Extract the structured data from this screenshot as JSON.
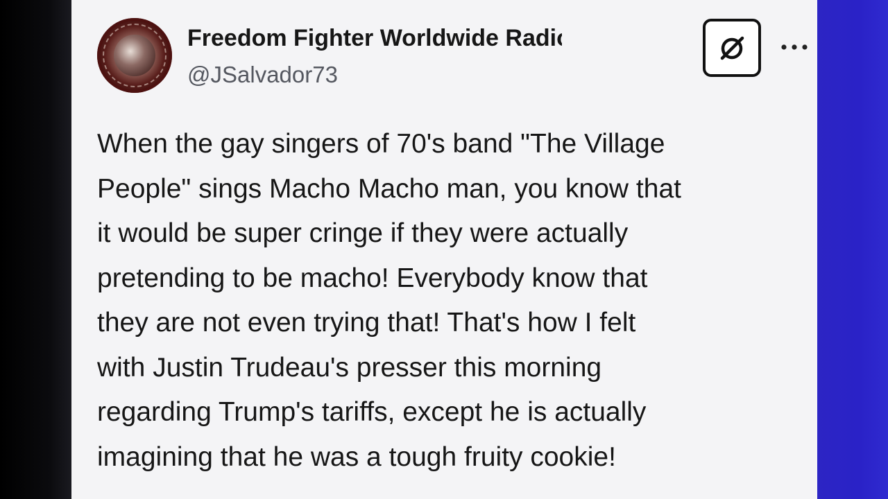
{
  "post": {
    "author": {
      "display_name": "Freedom Fighter Worldwide Radio ...",
      "handle": "@JSalvador73",
      "avatar_icon": "radio-station-avatar"
    },
    "actions": {
      "grok_icon": "grok-icon",
      "more_icon": "more-options-icon"
    },
    "text_lines": [
      "When the gay singers of 70's band \"The Village",
      "People\" sings Macho Macho man, you know that",
      "it would be super cringe if they were actually",
      "pretending to be macho! Everybody know that",
      "they are not even trying that! That's how I felt",
      "with Justin Trudeau's presser this morning",
      "regarding Trump's tariffs, except he is actually",
      "imagining that he was a tough fruity cookie!"
    ]
  },
  "colors": {
    "card_background": "#f4f4f6",
    "text_primary": "#161616",
    "text_secondary": "#555860",
    "right_band": "#2c25c4",
    "left_edge": "#000000"
  }
}
